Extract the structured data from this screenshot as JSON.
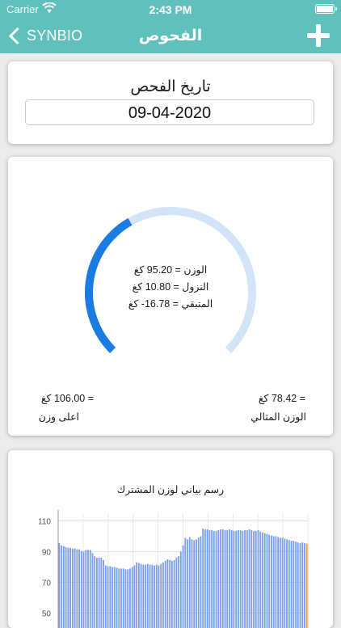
{
  "status_bar": {
    "carrier": "Carrier",
    "time": "2:43 PM"
  },
  "nav": {
    "back_label": "SYNBIO",
    "title": "الفحوص"
  },
  "date_card": {
    "title": "تاريخ الفحص",
    "value": "09-04-2020"
  },
  "gauge": {
    "progress": 0.39,
    "colors": {
      "track": "#d4e4f7",
      "fill": "#1a7be3"
    },
    "weight_line": "الوزن = 95.20 كغ",
    "loss_line": "النزول = 10.80 كغ",
    "remaining_line": "المتبقي = 16.78- كغ",
    "max_value": "= 106.00 كغ",
    "max_label": "اعلى وزن",
    "ideal_value": "= 78.42 كغ",
    "ideal_label": "الوزن المثالي"
  },
  "chart_data": {
    "type": "bar",
    "title": "رسم بياني لوزن المشترك",
    "xlabel": "",
    "ylabel": "",
    "yticks": [
      "110",
      "90",
      "70",
      "50"
    ],
    "ylim": [
      50,
      115
    ],
    "grid": true,
    "colors": {
      "bar": "#7b9ee8",
      "last_bar": "#f3a02a"
    },
    "values": [
      95.5,
      94,
      93.5,
      93,
      92.5,
      92.5,
      92,
      92,
      91.5,
      91.5,
      90.5,
      90,
      91,
      91,
      91,
      89,
      87,
      86,
      86,
      86,
      84.5,
      81,
      80.5,
      80.5,
      80,
      80,
      79.5,
      79,
      79,
      79,
      78.5,
      78.5,
      79,
      80,
      81,
      83,
      82.5,
      82,
      81.5,
      81.5,
      82,
      81.5,
      81.5,
      81,
      81.5,
      81,
      82,
      83,
      84,
      85,
      84.5,
      84,
      84.5,
      86,
      87,
      90,
      94,
      99,
      98,
      99.5,
      98,
      97.5,
      98,
      99,
      100,
      105,
      104.5,
      104.5,
      104,
      104,
      103.5,
      103.5,
      104,
      104.5,
      104.5,
      104,
      104,
      104.5,
      104,
      103.5,
      103.5,
      104,
      104,
      103.5,
      104,
      104,
      104.5,
      104,
      103.5,
      103.5,
      104,
      103,
      102.5,
      102,
      101.5,
      101,
      100.5,
      100,
      100,
      99.5,
      99,
      99,
      98.5,
      98,
      97.5,
      97,
      97,
      96.5,
      96,
      95.5,
      96,
      95.5,
      95.2
    ]
  }
}
